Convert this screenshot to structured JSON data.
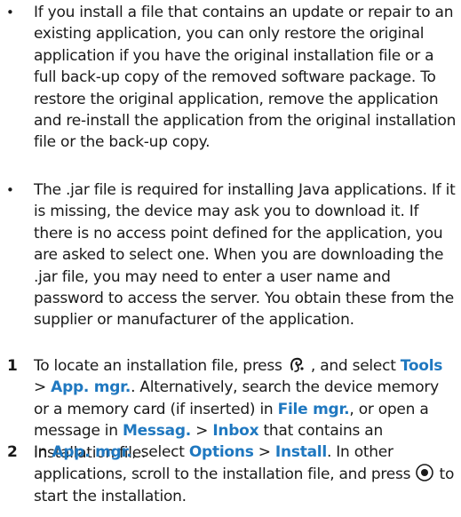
{
  "bullets": [
    {
      "marker": "•",
      "text": "If you install a file that contains an update or repair to an existing application, you can only restore the original application if you have the original installation file or a full back-up copy of the removed software package. To restore the original application, remove the application and re-install the application from the original installation file or the back-up copy."
    },
    {
      "marker": "•",
      "text": "The .jar file is required for installing Java applications. If it is missing, the device may ask you to download it. If there is no access point defined for the application, you are asked to select one. When you are downloading the .jar file, you may need to enter a user name and password to access the server. You obtain these from the supplier or manufacturer of the application."
    }
  ],
  "steps": [
    {
      "number": "1",
      "t1": "To locate an installation file, press ",
      "t2": " , and select ",
      "ui1": "Tools",
      "t3": " > ",
      "ui2": "App. mgr.",
      "t4": ". Alternatively, search the device memory or a memory card (if inserted) in ",
      "ui3": "File mgr.",
      "t5": ", or open a message in ",
      "ui4": "Messag.",
      "t6": " > ",
      "ui5": "Inbox",
      "t7": " that contains an installation file."
    },
    {
      "number": "2",
      "t1": "In ",
      "ui1": "App. mgr.",
      "t2": ", select ",
      "ui2": "Options",
      "t3": " > ",
      "ui3": "Install",
      "t4": ". In other applications, scroll to the installation file, and press ",
      "t5": " to start the installation."
    }
  ],
  "icons": {
    "menu_key": "menu-key-icon",
    "select_key": "selection-key-icon"
  },
  "colors": {
    "ui_label": "#1f78c0",
    "body_text": "#1a1a1a"
  }
}
